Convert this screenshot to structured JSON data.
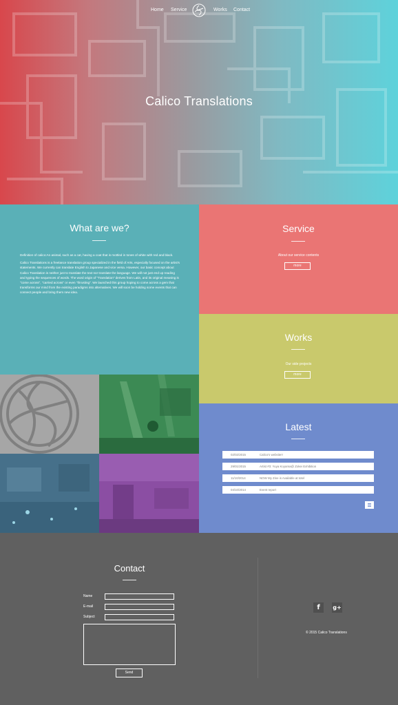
{
  "nav": {
    "items": [
      "Home",
      "Service",
      "Works",
      "Contact"
    ]
  },
  "hero": {
    "title": "Calico Translations"
  },
  "about": {
    "title": "What are we?",
    "paragraph1": "Definition of calico:An animal, such as a cat, having a coat that is mottled in tones of white with red and black.",
    "paragraph2": "Calico Translations is a freelance translation group specialized in the field of Arts, especially focused on the artist's statements. We currently can translate English to Japanese and vice versa. However, our basic concept about Calico Translation is neither just to translate the text nor translate the language. We will not just end up reading and typing the sequences of words. The word origin of \"Translation\" derives from Latin, and its original meaning is \"come across\", \"carried across\" or even \"thrusting\". We launched this group hoping to come across a gem that transforms our mind from the existing paradigms into alternatives. We will soon be holding some events that can connect people and bring them new idea."
  },
  "service": {
    "title": "Service",
    "text": "About our service contents",
    "button": "more"
  },
  "works": {
    "title": "Works",
    "text": "Our side projects",
    "button": "more"
  },
  "latest": {
    "title": "Latest",
    "items": [
      {
        "date": "02/02/2015",
        "title": "Calico's website!!"
      },
      {
        "date": "29/01/2015",
        "title": "Artist #3: Yuya Koyama@ Zokei Exhibition"
      },
      {
        "date": "11/10/2014",
        "title": "NOW My Zine is Available at totel"
      },
      {
        "date": "04/10/2014",
        "title": "Event report"
      }
    ]
  },
  "contact": {
    "title": "Contact",
    "labels": {
      "name": "Name",
      "email": "E-mail",
      "subject": "Subject"
    },
    "send": "Send"
  },
  "social": {
    "facebook": "f",
    "googleplus": "g+"
  },
  "footer": {
    "copyright": "© 2015 Calico Translations"
  },
  "colors": {
    "about": "#5ab0b7",
    "service": "#ea7574",
    "works": "#c9c96c",
    "latest": "#6f8bcd",
    "footer": "#606060"
  }
}
